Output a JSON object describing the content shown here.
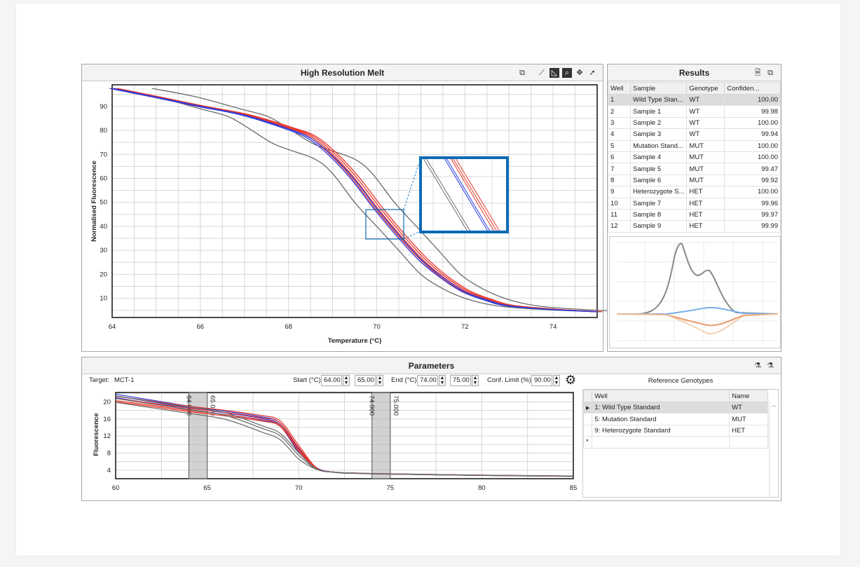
{
  "hrm": {
    "title": "High Resolution Melt",
    "toolbar_icons": [
      "copy-icon",
      "chart-line-icon",
      "chart-derivative-icon",
      "zoom-icon",
      "pan-icon",
      "select-arrow-icon"
    ]
  },
  "results": {
    "title": "Results",
    "columns": [
      "Well",
      "Sample",
      "Genotype",
      "Confiden..."
    ],
    "rows": [
      [
        "1",
        "Wild Type Stan...",
        "WT",
        "100.00"
      ],
      [
        "2",
        "Sample 1",
        "WT",
        "99.98"
      ],
      [
        "3",
        "Sample 2",
        "WT",
        "100.00"
      ],
      [
        "4",
        "Sample 3",
        "WT",
        "99.94"
      ],
      [
        "5",
        "Mutation Stand...",
        "MUT",
        "100.00"
      ],
      [
        "6",
        "Sample 4",
        "MUT",
        "100.00"
      ],
      [
        "7",
        "Sample 5",
        "MUT",
        "99.47"
      ],
      [
        "8",
        "Sample 6",
        "MUT",
        "99.92"
      ],
      [
        "9",
        "Heterozygote S...",
        "HET",
        "100.00"
      ],
      [
        "10",
        "Sample 7",
        "HET",
        "99.96"
      ],
      [
        "11",
        "Sample 8",
        "HET",
        "99.97"
      ],
      [
        "12",
        "Sample 9",
        "HET",
        "99.99"
      ]
    ]
  },
  "parameters": {
    "title": "Parameters",
    "target_label": "Target:",
    "target_value": "MCT-1",
    "start_label": "Start (°C)",
    "start_from": "64.00",
    "start_to": "65.00",
    "end_label": "End (°C)",
    "end_from": "74.00",
    "end_to": "75.00",
    "conf_label": "Conf. Limit (%)",
    "conf_value": "90.00",
    "marker_labels": [
      "64.000",
      "65.000",
      "74.000",
      "75.000"
    ]
  },
  "reference": {
    "title": "Reference Genotypes",
    "columns": [
      "Well",
      "Name"
    ],
    "rows": [
      [
        "1: Wild Type Standard",
        "WT"
      ],
      [
        "5: Mutation Standard",
        "MUT"
      ],
      [
        "9: Heterozygote Standard",
        "HET"
      ]
    ],
    "new_row_marker": "*"
  },
  "colors": {
    "wt": "#6b6b6b",
    "mut": "#e8372b",
    "het": "#2b3be0",
    "zoom_box": "#0a6ab4"
  },
  "chart_data": [
    {
      "type": "line",
      "title": "High Resolution Melt",
      "xlabel": "Temperature (°C)",
      "ylabel": "Normalised Fluorescence",
      "xlim": [
        64,
        75
      ],
      "ylim": [
        2,
        99
      ],
      "xticks": [
        64,
        66,
        68,
        70,
        72,
        74
      ],
      "yticks": [
        10,
        20,
        30,
        40,
        50,
        60,
        70,
        80,
        90
      ],
      "grid": true,
      "series": [
        {
          "group": "WT",
          "x": [
            64,
            65,
            66,
            66.6,
            67,
            67.6,
            68,
            68.6,
            69,
            69.5,
            70,
            70.5,
            71,
            71.5,
            72,
            72.5,
            73,
            74,
            75
          ],
          "y": [
            97.5,
            94,
            89,
            86,
            82,
            75,
            72,
            68,
            62,
            50,
            40,
            30,
            20,
            14,
            10,
            7.6,
            6.3,
            5.1,
            4.4
          ]
        },
        {
          "group": "MUT",
          "x": [
            64,
            65,
            66,
            67,
            68,
            68.5,
            69,
            69.5,
            70,
            70.5,
            71,
            71.5,
            72,
            72.5,
            73,
            74,
            75
          ],
          "y": [
            97.5,
            93.8,
            90,
            86.5,
            81,
            77.5,
            70,
            60,
            48,
            37,
            27,
            19,
            13,
            9.5,
            7,
            5.4,
            4.4
          ]
        },
        {
          "group": "HET",
          "x": [
            64,
            65,
            66,
            67,
            68,
            68.5,
            69,
            69.5,
            70,
            70.5,
            71,
            71.5,
            72,
            72.5,
            73,
            74,
            75
          ],
          "y": [
            97.5,
            93.8,
            90,
            86.3,
            80.5,
            76.5,
            69,
            59,
            47,
            36,
            26,
            18.5,
            12.6,
            9.2,
            6.8,
            5.3,
            4.4
          ]
        }
      ]
    },
    {
      "type": "line",
      "ylabel": "Fluorescence",
      "xlim": [
        60,
        85
      ],
      "ylim": [
        2,
        22.2
      ],
      "xticks": [
        60,
        65,
        70,
        75,
        80,
        85
      ],
      "yticks": [
        4,
        8,
        12,
        16,
        20
      ],
      "grid": true,
      "series": [
        {
          "group": "HET",
          "x": [
            60,
            62,
            64,
            66,
            68,
            69,
            70,
            71,
            72,
            73,
            75,
            80,
            85
          ],
          "y": [
            21.8,
            20.4,
            19,
            17.8,
            16.5,
            15,
            9,
            4.5,
            3.5,
            3.3,
            3.1,
            2.8,
            2.6
          ]
        },
        {
          "group": "MUT",
          "x": [
            60,
            62,
            64,
            66,
            68,
            69,
            70,
            71,
            72,
            73,
            75,
            80,
            85
          ],
          "y": [
            20.3,
            19.2,
            18,
            17,
            15.8,
            14.5,
            8.8,
            4.4,
            3.5,
            3.3,
            3.1,
            2.8,
            2.6
          ]
        },
        {
          "group": "WT",
          "x": [
            60,
            62,
            64,
            66,
            68,
            69,
            70,
            71,
            72,
            73,
            75,
            80,
            85
          ],
          "y": [
            20.8,
            19.5,
            18.2,
            16.8,
            13.8,
            12,
            7.5,
            4.2,
            3.5,
            3.3,
            3.1,
            2.8,
            2.6
          ]
        }
      ]
    }
  ]
}
